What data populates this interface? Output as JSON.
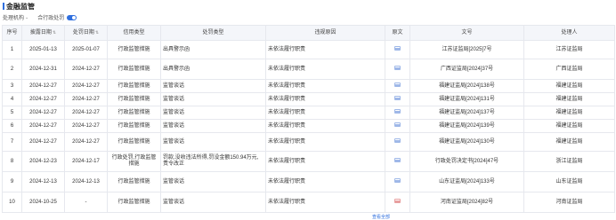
{
  "page": {
    "title": "金融监管"
  },
  "filters": {
    "org_label": "处理机构",
    "org_dropdown_icon": "chevron-down-icon",
    "merge_label": "合行政处罚",
    "merge_toggle": "on"
  },
  "table": {
    "headers": {
      "index": "序号",
      "publish_date": "披露日期",
      "penalty_date": "处罚日期",
      "credit_type": "信用类型",
      "penalty_type": "处罚类型",
      "reason": "违规原因",
      "original": "原文",
      "doc_no": "文号",
      "handler": "处理人"
    },
    "rows": [
      {
        "index": "1",
        "publish_date": "2025-01-13",
        "penalty_date": "2025-01-07",
        "credit_type": "行政监管措施",
        "penalty_type": "出具警示函",
        "reason": "未依法履行职责",
        "doc_no": "江苏证监局[2025]7号",
        "handler": "江苏证监局",
        "icon": "blue"
      },
      {
        "index": "2",
        "publish_date": "2024-12-31",
        "penalty_date": "2024-12-27",
        "credit_type": "行政监管措施",
        "penalty_type": "出具警示函",
        "reason": "未依法履行职责",
        "doc_no": "广西证监局[2024]37号",
        "handler": "广西证监局",
        "icon": "blue"
      },
      {
        "index": "3",
        "publish_date": "2024-12-27",
        "penalty_date": "2024-12-27",
        "credit_type": "行政监管措施",
        "penalty_type": "监管谈话",
        "reason": "未依法履行职责",
        "doc_no": "福建证监局[2024]138号",
        "handler": "福建证监局",
        "icon": "blue"
      },
      {
        "index": "4",
        "publish_date": "2024-12-27",
        "penalty_date": "2024-12-27",
        "credit_type": "行政监管措施",
        "penalty_type": "监管谈话",
        "reason": "未依法履行职责",
        "doc_no": "福建证监局[2024]131号",
        "handler": "福建证监局",
        "icon": "blue"
      },
      {
        "index": "5",
        "publish_date": "2024-12-27",
        "penalty_date": "2024-12-27",
        "credit_type": "行政监管措施",
        "penalty_type": "监管谈话",
        "reason": "未依法履行职责",
        "doc_no": "福建证监局[2024]137号",
        "handler": "福建证监局",
        "icon": "blue"
      },
      {
        "index": "6",
        "publish_date": "2024-12-27",
        "penalty_date": "2024-12-27",
        "credit_type": "行政监管措施",
        "penalty_type": "监管谈话",
        "reason": "未依法履行职责",
        "doc_no": "福建证监局[2024]139号",
        "handler": "福建证监局",
        "icon": "blue"
      },
      {
        "index": "7",
        "publish_date": "2024-12-27",
        "penalty_date": "2024-12-27",
        "credit_type": "行政监管措施",
        "penalty_type": "监管谈话",
        "reason": "未依法履行职责",
        "doc_no": "福建证监局[2024]130号",
        "handler": "福建证监局",
        "icon": "blue"
      },
      {
        "index": "8",
        "publish_date": "2024-12-23",
        "penalty_date": "2024-12-17",
        "credit_type": "行政处罚,行政监管措施",
        "penalty_type": "罚款,没收违法所得,罚没金额150.94万元,责令改正",
        "reason": "未依法履行职责",
        "doc_no": "行政处罚决定书[2024]47号",
        "handler": "浙江证监局",
        "icon": "blue"
      },
      {
        "index": "9",
        "publish_date": "2024-12-13",
        "penalty_date": "2024-12-13",
        "credit_type": "行政监管措施",
        "penalty_type": "监管谈话",
        "reason": "未依法履行职责",
        "doc_no": "山东证监局[2024]133号",
        "handler": "山东证监局",
        "icon": "blue"
      },
      {
        "index": "10",
        "publish_date": "2024-10-25",
        "penalty_date": "-",
        "credit_type": "行政监管措施",
        "penalty_type": "监管谈话",
        "reason": "未依法履行职责",
        "doc_no": "河南证监局[2024]82号",
        "handler": "河南证监局",
        "icon": "red"
      }
    ]
  },
  "footer": {
    "more_label": "查看全部"
  }
}
